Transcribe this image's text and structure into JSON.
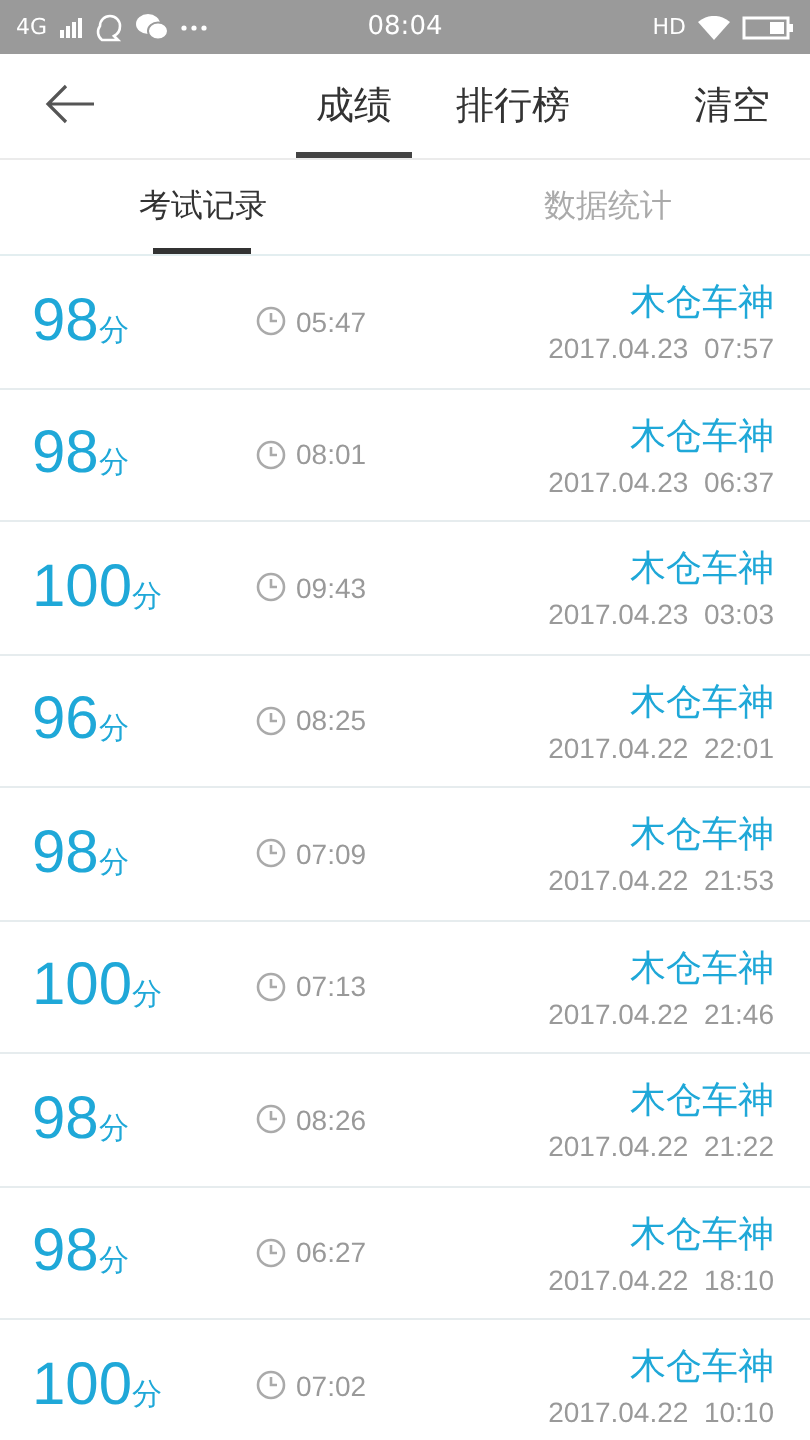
{
  "status_bar": {
    "network": "4G",
    "time": "08:04",
    "hd": "HD"
  },
  "header": {
    "tabs": [
      {
        "label": "成绩",
        "selected": true
      },
      {
        "label": "排行榜",
        "selected": false
      }
    ],
    "action": "清空"
  },
  "sub_tabs": [
    {
      "label": "考试记录",
      "selected": true
    },
    {
      "label": "数据统计",
      "selected": false
    }
  ],
  "records": [
    {
      "score": "98",
      "unit": "分",
      "duration": "05:47",
      "name": "木仓车神",
      "date": "2017.04.23  07:57"
    },
    {
      "score": "98",
      "unit": "分",
      "duration": "08:01",
      "name": "木仓车神",
      "date": "2017.04.23  06:37"
    },
    {
      "score": "100",
      "unit": "分",
      "duration": "09:43",
      "name": "木仓车神",
      "date": "2017.04.23  03:03"
    },
    {
      "score": "96",
      "unit": "分",
      "duration": "08:25",
      "name": "木仓车神",
      "date": "2017.04.22  22:01"
    },
    {
      "score": "98",
      "unit": "分",
      "duration": "07:09",
      "name": "木仓车神",
      "date": "2017.04.22  21:53"
    },
    {
      "score": "100",
      "unit": "分",
      "duration": "07:13",
      "name": "木仓车神",
      "date": "2017.04.22  21:46"
    },
    {
      "score": "98",
      "unit": "分",
      "duration": "08:26",
      "name": "木仓车神",
      "date": "2017.04.22  21:22"
    },
    {
      "score": "98",
      "unit": "分",
      "duration": "06:27",
      "name": "木仓车神",
      "date": "2017.04.22  18:10"
    },
    {
      "score": "100",
      "unit": "分",
      "duration": "07:02",
      "name": "木仓车神",
      "date": "2017.04.22  10:10"
    }
  ]
}
